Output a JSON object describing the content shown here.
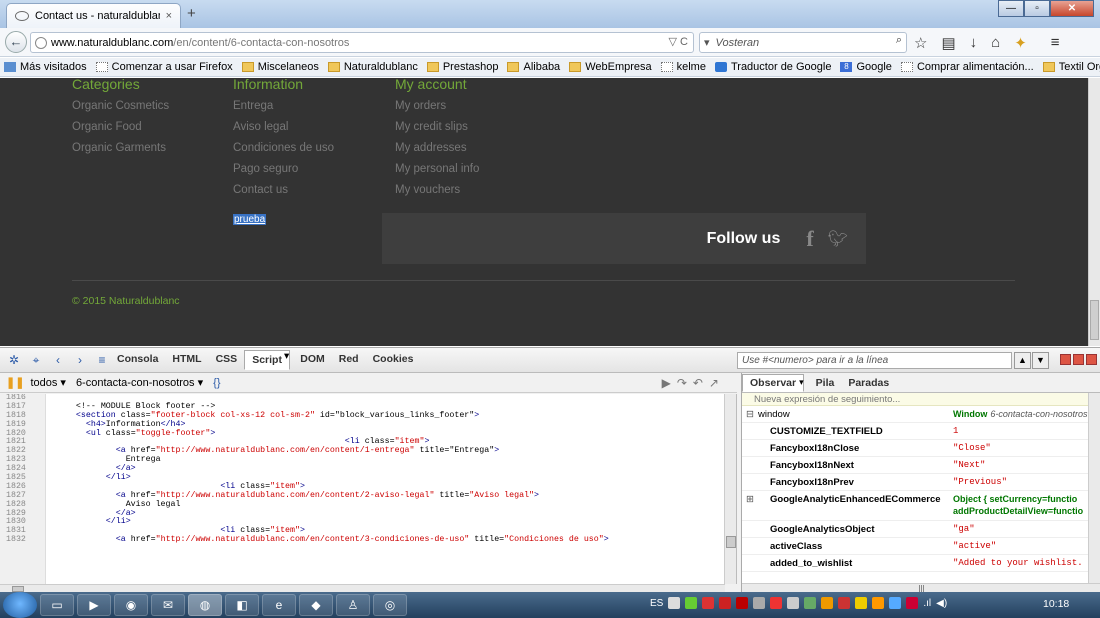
{
  "browser": {
    "tab_title": "Contact us - naturaldublanc",
    "tab_close": "×",
    "new_tab": "+",
    "url_domain": "www.naturaldublanc.com",
    "url_path": "/en/content/6-contacta-con-nosotros",
    "url_controls": "▽ C",
    "search_value": "Vosteran",
    "search_engine": "▾",
    "window_min": "—",
    "window_max": "▫",
    "window_close": "✕"
  },
  "bookmarks": [
    {
      "label": "Más visitados",
      "icon": "star"
    },
    {
      "label": "Comenzar a usar Firefox",
      "icon": "page"
    },
    {
      "label": "Miscelaneos",
      "icon": "folder"
    },
    {
      "label": "Naturaldublanc",
      "icon": "folder"
    },
    {
      "label": "Prestashop",
      "icon": "folder"
    },
    {
      "label": "Alibaba",
      "icon": "folder"
    },
    {
      "label": "WebEmpresa",
      "icon": "folder"
    },
    {
      "label": "kelme",
      "icon": "page"
    },
    {
      "label": "Traductor de Google",
      "icon": "gt"
    },
    {
      "label": "Google",
      "icon": "g"
    },
    {
      "label": "Comprar alimentación...",
      "icon": "page"
    },
    {
      "label": "Textil Organico",
      "icon": "folder"
    }
  ],
  "footer": {
    "categories": {
      "title": "Categories",
      "links": [
        "Organic Cosmetics",
        "Organic Food",
        "Organic Garments"
      ]
    },
    "information": {
      "title": "Information",
      "links": [
        "Entrega",
        "Aviso legal",
        "Condiciones de uso",
        "Pago seguro",
        "Contact us"
      ]
    },
    "account": {
      "title": "My account",
      "links": [
        "My orders",
        "My credit slips",
        "My addresses",
        "My personal info",
        "My vouchers"
      ]
    },
    "prueba": "prueba",
    "follow": "Follow us",
    "facebook": "f",
    "copyright": "© 2015 Naturaldublanc"
  },
  "firebug": {
    "tabs": [
      "Consola",
      "HTML",
      "CSS",
      "Script",
      "DOM",
      "Red",
      "Cookies"
    ],
    "selected_tab": "Script",
    "search_placeholder": "Use #<numero> para ir a la línea",
    "filter": "todos",
    "file": "6-contacta-con-nosotros",
    "braces": "{}",
    "watch_tabs": [
      "Observar",
      "Pila",
      "Paradas"
    ],
    "new_expression": "Nueva expresión de seguimiento...",
    "lines": [
      "1816",
      "1817",
      "1818",
      "1819",
      "1820",
      "1821",
      "1822",
      "1823",
      "1824",
      "1825",
      "1826",
      "1827",
      "1828",
      "1829",
      "1830",
      "1831",
      "1832"
    ],
    "watch_rows": [
      {
        "expand": "⊟",
        "key": "window",
        "value": "Window",
        "sub": "6-contacta-con-nosotros",
        "obj": true
      },
      {
        "expand": "",
        "key": "CUSTOMIZE_TEXTFIELD",
        "value": "1"
      },
      {
        "expand": "",
        "key": "FancyboxI18nClose",
        "value": "\"Close\""
      },
      {
        "expand": "",
        "key": "FancyboxI18nNext",
        "value": "\"Next\""
      },
      {
        "expand": "",
        "key": "FancyboxI18nPrev",
        "value": "\"Previous\""
      },
      {
        "expand": "⊞",
        "key": "GoogleAnalyticEnhancedECommerce",
        "value": "Object { setCurrency=functio",
        "value2": "addProductDetailView=functio",
        "obj": true
      },
      {
        "expand": "",
        "key": "GoogleAnalyticsObject",
        "value": "\"ga\""
      },
      {
        "expand": "",
        "key": "activeClass",
        "value": "\"active\""
      },
      {
        "expand": "",
        "key": "added_to_wishlist",
        "value": "\"Added to your wishlist."
      }
    ]
  },
  "taskbar": {
    "lang": "ES",
    "time": "10:18"
  }
}
